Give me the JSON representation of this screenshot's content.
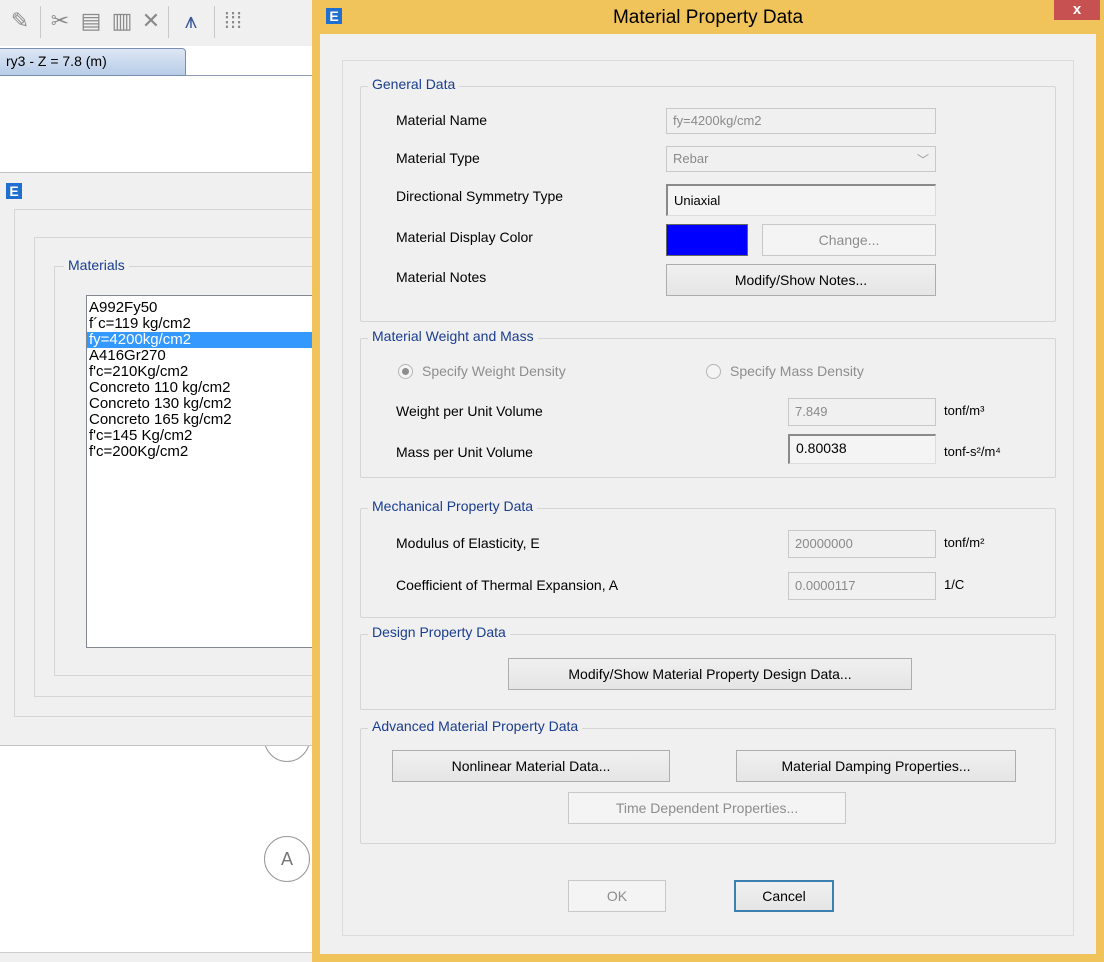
{
  "background": {
    "toolbar_icons": [
      "pencil-icon",
      "scissors-icon",
      "copy-icon",
      "paste-icon",
      "delete-icon",
      "chart-icon",
      "grid-icon"
    ],
    "view_tab": "ry3 - Z = 7.8 (m)",
    "grid_bubble_label": "A",
    "materials_dialog": {
      "group_label": "Materials",
      "items": [
        "A992Fy50",
        "f´c=119 kg/cm2",
        "fy=4200kg/cm2",
        "A416Gr270",
        "f'c=210Kg/cm2",
        "Concreto 110 kg/cm2",
        "Concreto 130 kg/cm2",
        "Concreto 165 kg/cm2",
        "f'c=145 Kg/cm2",
        "f'c=200Kg/cm2"
      ],
      "selected_index": 2
    }
  },
  "dialog": {
    "title": "Material Property Data",
    "close_label": "x",
    "general": {
      "group_label": "General Data",
      "name_label": "Material Name",
      "name_value": "fy=4200kg/cm2",
      "type_label": "Material Type",
      "type_value": "Rebar",
      "symmetry_label": "Directional Symmetry Type",
      "symmetry_value": "Uniaxial",
      "color_label": "Material Display Color",
      "color_value": "#0000ff",
      "change_label": "Change...",
      "notes_label": "Material Notes",
      "notes_button": "Modify/Show Notes..."
    },
    "weight_mass": {
      "group_label": "Material Weight and Mass",
      "weight_density_option": "Specify Weight Density",
      "mass_density_option": "Specify Mass Density",
      "weight_label": "Weight per Unit Volume",
      "weight_value": "7.849",
      "weight_unit": "tonf/m³",
      "mass_label": "Mass per Unit Volume",
      "mass_value": "0.80038",
      "mass_unit": "tonf-s²/m⁴"
    },
    "mechanical": {
      "group_label": "Mechanical Property Data",
      "modulus_label": "Modulus of Elasticity,  E",
      "modulus_value": "20000000",
      "modulus_unit": "tonf/m²",
      "thermal_label": "Coefficient of Thermal Expansion,  A",
      "thermal_value": "0.0000117",
      "thermal_unit": "1/C"
    },
    "design": {
      "group_label": "Design Property Data",
      "button": "Modify/Show Material Property Design Data..."
    },
    "advanced": {
      "group_label": "Advanced Material Property Data",
      "nonlinear_button": "Nonlinear Material Data...",
      "damping_button": "Material Damping Properties...",
      "time_button": "Time Dependent Properties..."
    },
    "ok_label": "OK",
    "cancel_label": "Cancel"
  }
}
